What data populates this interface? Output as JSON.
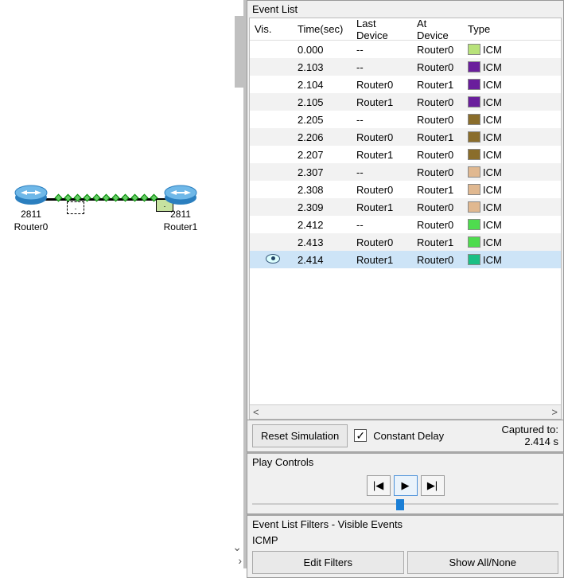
{
  "topology": {
    "router0": {
      "model": "2811",
      "name": "Router0"
    },
    "router1": {
      "model": "2811",
      "name": "Router1"
    }
  },
  "event_list": {
    "title": "Event List",
    "columns": {
      "vis": "Vis.",
      "time": "Time(sec)",
      "last": "Last Device",
      "at": "At Device",
      "type": "Type"
    },
    "rows": [
      {
        "time": "0.000",
        "last": "--",
        "at": "Router0",
        "type": "ICMP",
        "color": "#b8e27a",
        "selected": false,
        "eye": false
      },
      {
        "time": "2.103",
        "last": "--",
        "at": "Router0",
        "type": "ICMP",
        "color": "#6a1e9c",
        "selected": false,
        "eye": false
      },
      {
        "time": "2.104",
        "last": "Router0",
        "at": "Router1",
        "type": "ICMP",
        "color": "#6a1e9c",
        "selected": false,
        "eye": false
      },
      {
        "time": "2.105",
        "last": "Router1",
        "at": "Router0",
        "type": "ICMP",
        "color": "#6a1e9c",
        "selected": false,
        "eye": false
      },
      {
        "time": "2.205",
        "last": "--",
        "at": "Router0",
        "type": "ICMP",
        "color": "#8a6d2b",
        "selected": false,
        "eye": false
      },
      {
        "time": "2.206",
        "last": "Router0",
        "at": "Router1",
        "type": "ICMP",
        "color": "#8a6d2b",
        "selected": false,
        "eye": false
      },
      {
        "time": "2.207",
        "last": "Router1",
        "at": "Router0",
        "type": "ICMP",
        "color": "#8a6d2b",
        "selected": false,
        "eye": false
      },
      {
        "time": "2.307",
        "last": "--",
        "at": "Router0",
        "type": "ICMP",
        "color": "#e0b890",
        "selected": false,
        "eye": false
      },
      {
        "time": "2.308",
        "last": "Router0",
        "at": "Router1",
        "type": "ICMP",
        "color": "#e0b890",
        "selected": false,
        "eye": false
      },
      {
        "time": "2.309",
        "last": "Router1",
        "at": "Router0",
        "type": "ICMP",
        "color": "#e0b890",
        "selected": false,
        "eye": false
      },
      {
        "time": "2.412",
        "last": "--",
        "at": "Router0",
        "type": "ICMP",
        "color": "#4edc4e",
        "selected": false,
        "eye": false
      },
      {
        "time": "2.413",
        "last": "Router0",
        "at": "Router1",
        "type": "ICMP",
        "color": "#4edc4e",
        "selected": false,
        "eye": false
      },
      {
        "time": "2.414",
        "last": "Router1",
        "at": "Router0",
        "type": "ICMP",
        "color": "#1bbf84",
        "selected": true,
        "eye": true
      }
    ]
  },
  "sim": {
    "reset": "Reset Simulation",
    "constant_delay": "Constant Delay",
    "captured_label": "Captured to:",
    "captured_value": "2.414 s"
  },
  "play": {
    "title": "Play Controls",
    "prev_glyph": "|◀",
    "play_glyph": "▶",
    "next_glyph": "▶|",
    "slider_pos_pct": 47
  },
  "filters": {
    "title": "Event List Filters - Visible Events",
    "list": "ICMP",
    "edit": "Edit Filters",
    "show_all": "Show All/None"
  }
}
